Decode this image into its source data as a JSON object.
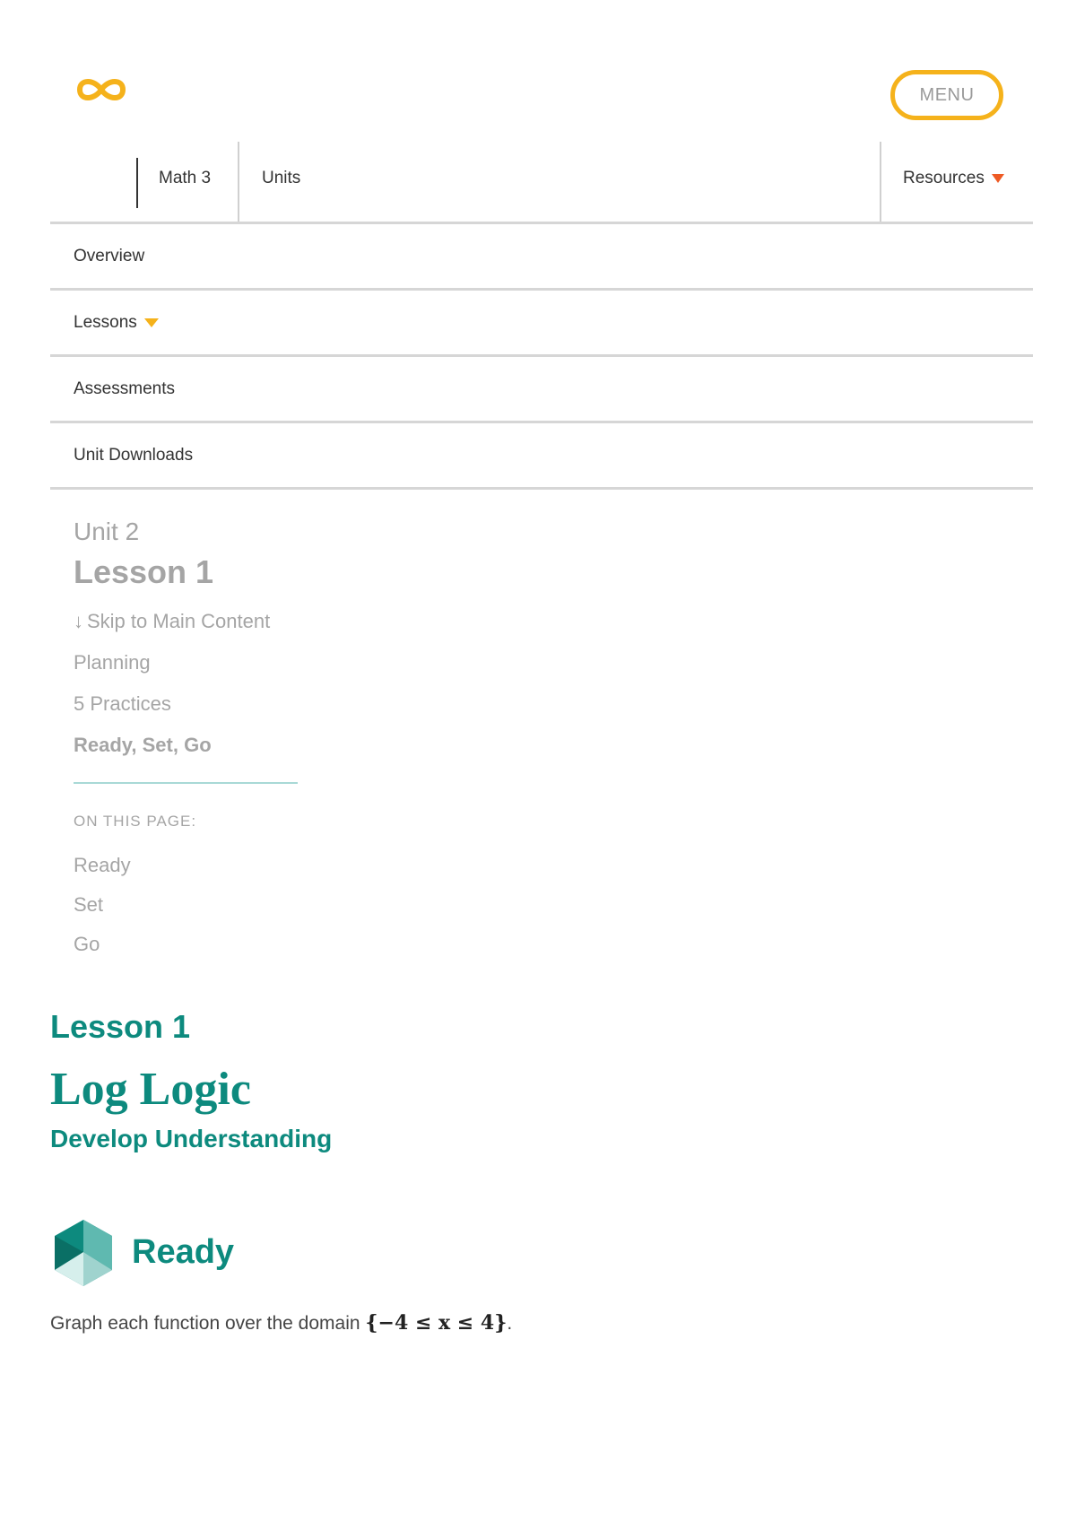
{
  "header": {
    "menu_label": "MENU"
  },
  "breadcrumb": {
    "course": "Math 3",
    "units": "Units",
    "resources": "Resources"
  },
  "nav": {
    "items": [
      {
        "label": "Overview"
      },
      {
        "label": "Lessons"
      },
      {
        "label": "Assessments"
      },
      {
        "label": "Unit Downloads"
      }
    ]
  },
  "toc": {
    "unit": "Unit 2",
    "lesson": "Lesson 1",
    "skip_arrow": "↓",
    "skip_label": "Skip to Main Content",
    "links": [
      "Planning",
      "5 Practices",
      "Ready, Set, Go"
    ],
    "on_this_page_label": "ON THIS PAGE:",
    "page_links": [
      "Ready",
      "Set",
      "Go"
    ]
  },
  "main": {
    "lesson": "Lesson 1",
    "title": "Log Logic",
    "subtitle": "Develop Understanding",
    "section_heading": "Ready",
    "instruction_text": "Graph each function over the domain ",
    "instruction_math": "{−4 ≤ x ≤ 4}",
    "instruction_end": "."
  },
  "colors": {
    "accent_yellow": "#f5b21b",
    "accent_orange": "#ee5a24",
    "teal": "#0d8a7e",
    "muted_gray": "#a5a5a5"
  },
  "icons": {
    "logo": "infinity-logo-icon",
    "resources_caret": "caret-down-icon",
    "lessons_caret": "caret-down-icon",
    "ready_icon": "ready-hexagon-icon"
  }
}
